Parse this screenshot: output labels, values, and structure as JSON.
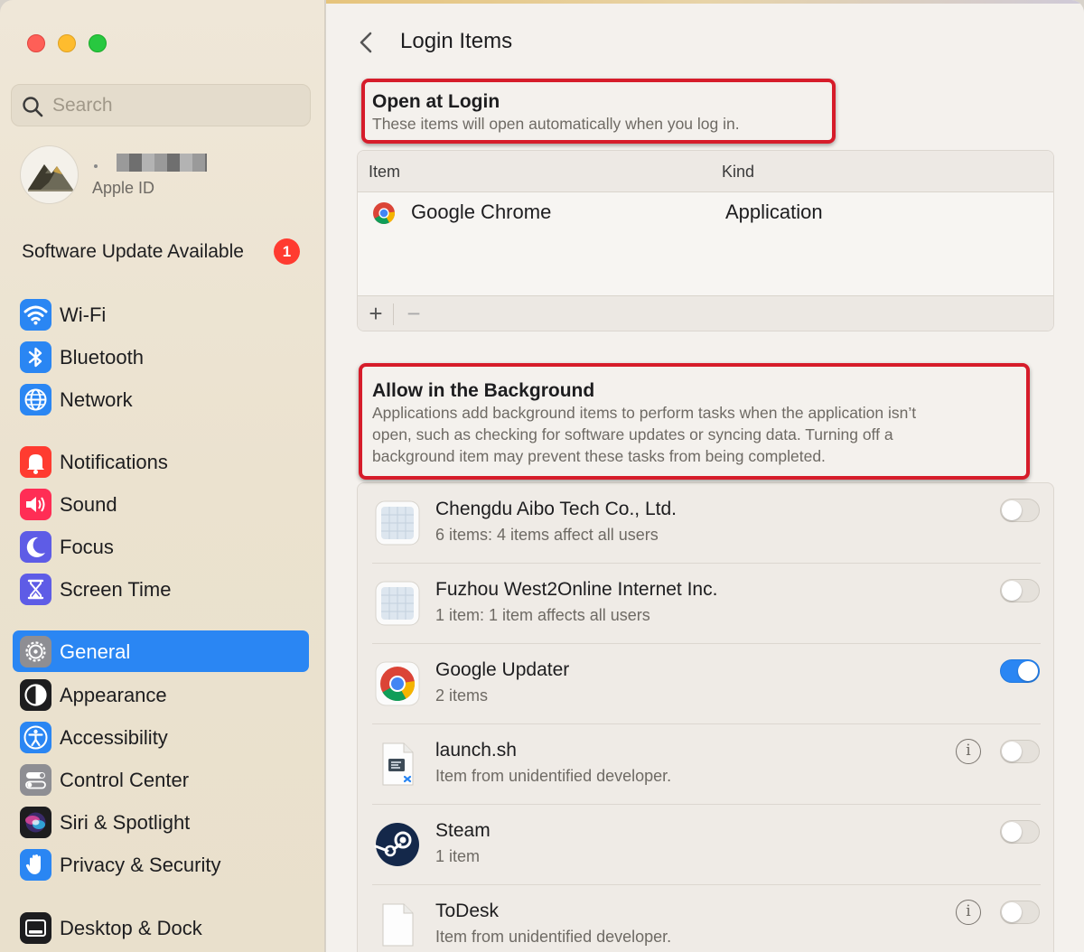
{
  "sidebar": {
    "search": {
      "placeholder": "Search"
    },
    "apple_id": {
      "label": "Apple ID"
    },
    "software_update": {
      "label": "Software Update Available",
      "badge": "1"
    },
    "items": [
      {
        "id": "wifi",
        "label": "Wi-Fi",
        "icon": "wifi-icon",
        "color": "#2a86f3"
      },
      {
        "id": "bluetooth",
        "label": "Bluetooth",
        "icon": "bluetooth-icon",
        "color": "#2a86f3"
      },
      {
        "id": "network",
        "label": "Network",
        "icon": "globe-icon",
        "color": "#2a86f3"
      },
      {
        "id": "notifications",
        "label": "Notifications",
        "icon": "bell-icon",
        "color": "#ff3b30"
      },
      {
        "id": "sound",
        "label": "Sound",
        "icon": "speaker-icon",
        "color": "#ff2d55"
      },
      {
        "id": "focus",
        "label": "Focus",
        "icon": "moon-icon",
        "color": "#5e5ce6"
      },
      {
        "id": "screen-time",
        "label": "Screen Time",
        "icon": "hourglass-icon",
        "color": "#5e5ce6"
      },
      {
        "id": "general",
        "label": "General",
        "icon": "gear-icon",
        "color": "#8e8e93",
        "selected": true
      },
      {
        "id": "appearance",
        "label": "Appearance",
        "icon": "appearance-icon",
        "color": "#1d1d1f"
      },
      {
        "id": "accessibility",
        "label": "Accessibility",
        "icon": "accessibility-icon",
        "color": "#2a86f3"
      },
      {
        "id": "control-center",
        "label": "Control Center",
        "icon": "toggles-icon",
        "color": "#8e8e93"
      },
      {
        "id": "siri",
        "label": "Siri & Spotlight",
        "icon": "siri-icon",
        "color": "#1d1d1f"
      },
      {
        "id": "privacy",
        "label": "Privacy & Security",
        "icon": "hand-icon",
        "color": "#2a86f3"
      },
      {
        "id": "desktop-dock",
        "label": "Desktop & Dock",
        "icon": "dock-icon",
        "color": "#1d1d1f"
      }
    ]
  },
  "header": {
    "title": "Login Items"
  },
  "open_at_login": {
    "title": "Open at Login",
    "description": "These items will open automatically when you log in.",
    "columns": [
      "Item",
      "Kind"
    ],
    "rows": [
      {
        "item": "Google Chrome",
        "kind": "Application",
        "icon": "chrome-icon"
      }
    ],
    "add_label": "+",
    "remove_label": "−"
  },
  "background": {
    "title": "Allow in the Background",
    "description_lines": [
      "Applications add background items to perform tasks when the application isn’t",
      "open, such as checking for software updates or syncing data. Turning off a",
      "background item may prevent these tasks from being completed."
    ],
    "items": [
      {
        "name": "Chengdu Aibo Tech Co., Ltd.",
        "detail": "6 items: 4 items affect all users",
        "enabled": false,
        "info": false,
        "icon": "generic-app-icon"
      },
      {
        "name": "Fuzhou West2Online Internet Inc.",
        "detail": "1 item: 1 item affects all users",
        "enabled": false,
        "info": false,
        "icon": "generic-app-icon"
      },
      {
        "name": "Google Updater",
        "detail": "2 items",
        "enabled": true,
        "info": false,
        "icon": "chrome-icon"
      },
      {
        "name": "launch.sh",
        "detail": "Item from unidentified developer.",
        "enabled": false,
        "info": true,
        "icon": "script-file-icon"
      },
      {
        "name": "Steam",
        "detail": "1 item",
        "enabled": false,
        "info": false,
        "icon": "steam-icon"
      },
      {
        "name": "ToDesk",
        "detail": "Item from unidentified developer.",
        "enabled": false,
        "info": true,
        "icon": "document-icon"
      }
    ]
  },
  "colors": {
    "accent": "#2a86f3",
    "annotation": "#d61c2a",
    "badge": "#ff3b30"
  }
}
